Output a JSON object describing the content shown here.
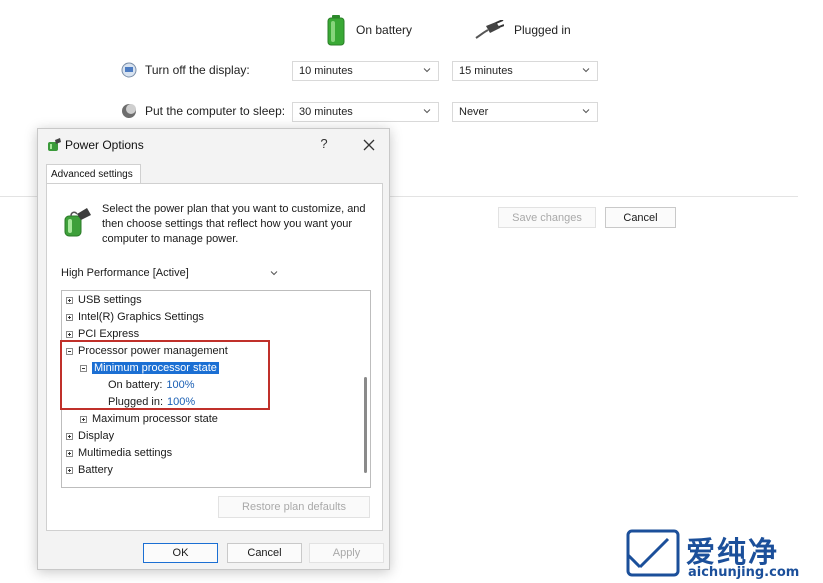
{
  "plan_settings": {
    "columns": {
      "battery_label": "On battery",
      "plugged_label": "Plugged in"
    },
    "rows": [
      {
        "label": "Turn off the display:",
        "battery_value": "10 minutes",
        "plugged_value": "15 minutes"
      },
      {
        "label": "Put the computer to sleep:",
        "battery_value": "30 minutes",
        "plugged_value": "Never"
      }
    ],
    "save_label": "Save changes",
    "cancel_label": "Cancel"
  },
  "dialog": {
    "title": "Power Options",
    "help_glyph": "?",
    "tab_label": "Advanced settings",
    "description": "Select the power plan that you want to customize, and then choose settings that reflect how you want your computer to manage power.",
    "plan_select": "High Performance [Active]",
    "tree": {
      "usb": "USB settings",
      "graphics": "Intel(R) Graphics Settings",
      "pci": "PCI Express",
      "processor": "Processor power management",
      "min_state": "Minimum processor state",
      "on_battery_label": "On battery:",
      "on_battery_value": "100%",
      "plugged_in_label": "Plugged in:",
      "plugged_in_value": "100%",
      "max_state": "Maximum processor state",
      "display": "Display",
      "multimedia": "Multimedia settings",
      "battery": "Battery"
    },
    "restore_label": "Restore plan defaults",
    "ok_label": "OK",
    "cancel_label": "Cancel",
    "apply_label": "Apply"
  },
  "watermark": {
    "chinese": "爱纯净",
    "url": "aichunjing.com"
  },
  "colors": {
    "selection": "#1b6fd3",
    "highlight_box": "#c0302a",
    "value_text": "#1a5fb4",
    "watermark": "#1b4f9a"
  }
}
